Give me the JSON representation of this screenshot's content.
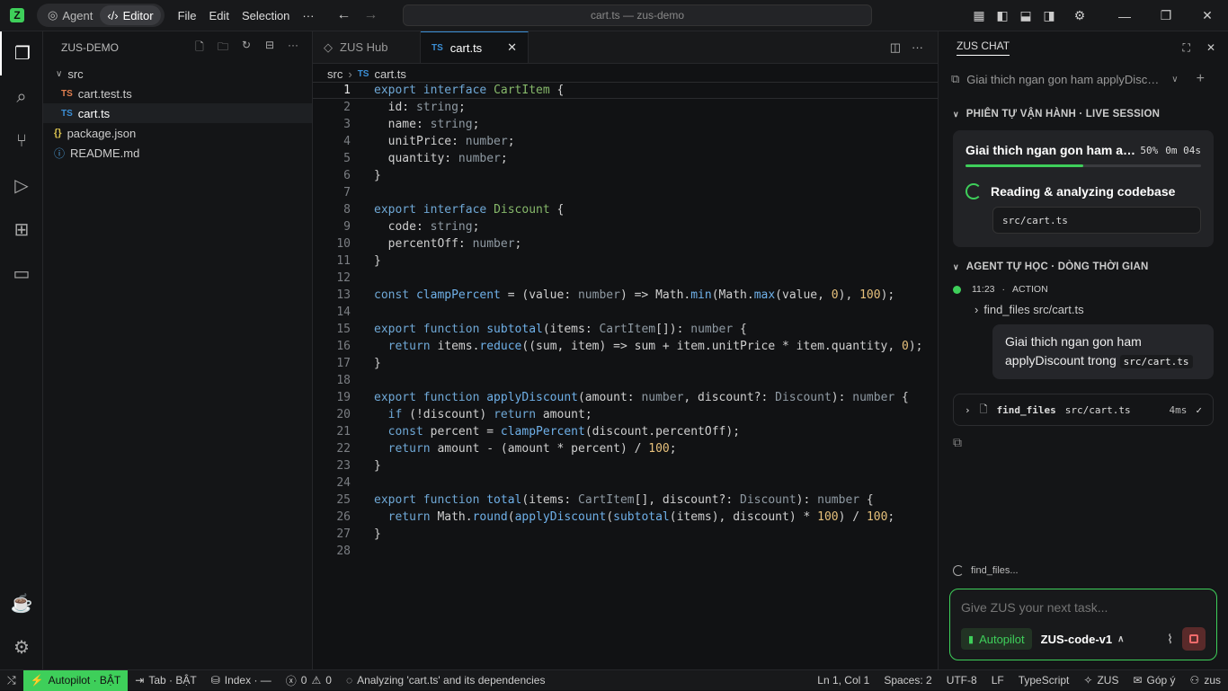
{
  "titlebar": {
    "logo": "Z",
    "modes": [
      "Agent",
      "Editor"
    ],
    "menu": [
      "File",
      "Edit",
      "Selection",
      "···"
    ],
    "command_center": "cart.ts — zus-demo"
  },
  "sidebar": {
    "title": "ZUS-DEMO",
    "folder": "src",
    "files": [
      {
        "badge": "TS",
        "name": "cart.test.ts"
      },
      {
        "badge": "TS",
        "name": "cart.ts"
      }
    ],
    "root_files": [
      {
        "badge": "{}",
        "name": "package.json"
      },
      {
        "badge": "ⓘ",
        "name": "README.md"
      }
    ]
  },
  "editor": {
    "tabs": [
      {
        "label": "ZUS Hub"
      },
      {
        "badge": "TS",
        "label": "cart.ts"
      }
    ],
    "breadcrumb": [
      "src",
      "cart.ts"
    ],
    "breadcrumb_badge": "TS"
  },
  "chat": {
    "title": "ZUS CHAT",
    "history_title": "Giai thich ngan gon ham applyDiscou...",
    "session_section": "PHIÊN TỰ VẬN HÀNH · LIVE SESSION",
    "session": {
      "title": "Giai thich ngan gon ham ap...",
      "percent": "50%",
      "progress": 0.5,
      "elapsed": "0m 04s",
      "status": "Reading & analyzing codebase",
      "file": "src/cart.ts"
    },
    "timeline_section": "AGENT TỰ HỌC · DÒNG THỜI GIAN",
    "timeline": {
      "time": "11:23",
      "kind": "ACTION",
      "action": "find_files src/cart.ts"
    },
    "bubble_text": "Giai thich ngan gon ham applyDiscount trong",
    "bubble_code": "src/cart.ts",
    "tool": {
      "name": "find_files",
      "arg": "src/cart.ts",
      "ms": "4ms"
    },
    "thinking": "find_files...",
    "composer": {
      "placeholder": "Give ZUS your next task...",
      "autopilot": "Autopilot",
      "model": "ZUS-code-v1"
    }
  },
  "statusbar": {
    "autopilot": "Autopilot · BẬT",
    "tab": "Tab · BẬT",
    "index": "Index · —",
    "errors": "0",
    "warnings": "0",
    "analyzing": "Analyzing 'cart.ts' and its dependencies",
    "position": "Ln 1, Col 1",
    "spaces": "Spaces: 2",
    "encoding": "UTF-8",
    "eol": "LF",
    "language": "TypeScript",
    "zus": "ZUS",
    "feedback": "Góp ý",
    "account": "zus"
  },
  "colors": {
    "accent": "#3ecf5a",
    "ts_blue": "#3b8fd6",
    "keyword": "#6fa8d6",
    "number": "#e6c07b"
  },
  "code_lines": [
    [
      [
        "kw",
        "export interface "
      ],
      [
        "ty",
        "CartItem"
      ],
      [
        "op",
        " {"
      ]
    ],
    [
      [
        "op",
        "  id: "
      ],
      [
        "tt",
        "string"
      ],
      [
        "op",
        ";"
      ]
    ],
    [
      [
        "op",
        "  name: "
      ],
      [
        "tt",
        "string"
      ],
      [
        "op",
        ";"
      ]
    ],
    [
      [
        "op",
        "  unitPrice: "
      ],
      [
        "tt",
        "number"
      ],
      [
        "op",
        ";"
      ]
    ],
    [
      [
        "op",
        "  quantity: "
      ],
      [
        "tt",
        "number"
      ],
      [
        "op",
        ";"
      ]
    ],
    [
      [
        "op",
        "}"
      ]
    ],
    [],
    [
      [
        "kw",
        "export interface "
      ],
      [
        "ty",
        "Discount"
      ],
      [
        "op",
        " {"
      ]
    ],
    [
      [
        "op",
        "  code: "
      ],
      [
        "tt",
        "string"
      ],
      [
        "op",
        ";"
      ]
    ],
    [
      [
        "op",
        "  percentOff: "
      ],
      [
        "tt",
        "number"
      ],
      [
        "op",
        ";"
      ]
    ],
    [
      [
        "op",
        "}"
      ]
    ],
    [],
    [
      [
        "kw",
        "const "
      ],
      [
        "fn",
        "clampPercent"
      ],
      [
        "op",
        " = (value: "
      ],
      [
        "tt",
        "number"
      ],
      [
        "op",
        ") => Math."
      ],
      [
        "fn",
        "min"
      ],
      [
        "op",
        "(Math."
      ],
      [
        "fn",
        "max"
      ],
      [
        "op",
        "(value, "
      ],
      [
        "num",
        "0"
      ],
      [
        "op",
        "), "
      ],
      [
        "num",
        "100"
      ],
      [
        "op",
        ");"
      ]
    ],
    [],
    [
      [
        "kw",
        "export function "
      ],
      [
        "fn",
        "subtotal"
      ],
      [
        "op",
        "(items: "
      ],
      [
        "tt",
        "CartItem"
      ],
      [
        "op",
        "[]): "
      ],
      [
        "tt",
        "number"
      ],
      [
        "op",
        " {"
      ]
    ],
    [
      [
        "kw",
        "  return "
      ],
      [
        "op",
        "items."
      ],
      [
        "fn",
        "reduce"
      ],
      [
        "op",
        "((sum, item) => sum + item.unitPrice * item.quantity, "
      ],
      [
        "num",
        "0"
      ],
      [
        "op",
        ");"
      ]
    ],
    [
      [
        "op",
        "}"
      ]
    ],
    [],
    [
      [
        "kw",
        "export function "
      ],
      [
        "fn",
        "applyDiscount"
      ],
      [
        "op",
        "(amount: "
      ],
      [
        "tt",
        "number"
      ],
      [
        "op",
        ", discount?: "
      ],
      [
        "tt",
        "Discount"
      ],
      [
        "op",
        "): "
      ],
      [
        "tt",
        "number"
      ],
      [
        "op",
        " {"
      ]
    ],
    [
      [
        "kw",
        "  if "
      ],
      [
        "op",
        "(!discount) "
      ],
      [
        "kw",
        "return "
      ],
      [
        "op",
        "amount;"
      ]
    ],
    [
      [
        "kw",
        "  const "
      ],
      [
        "op",
        "percent = "
      ],
      [
        "fn",
        "clampPercent"
      ],
      [
        "op",
        "(discount.percentOff);"
      ]
    ],
    [
      [
        "kw",
        "  return "
      ],
      [
        "op",
        "amount - (amount * percent) / "
      ],
      [
        "num",
        "100"
      ],
      [
        "op",
        ";"
      ]
    ],
    [
      [
        "op",
        "}"
      ]
    ],
    [],
    [
      [
        "kw",
        "export function "
      ],
      [
        "fn",
        "total"
      ],
      [
        "op",
        "(items: "
      ],
      [
        "tt",
        "CartItem"
      ],
      [
        "op",
        "[], discount?: "
      ],
      [
        "tt",
        "Discount"
      ],
      [
        "op",
        "): "
      ],
      [
        "tt",
        "number"
      ],
      [
        "op",
        " {"
      ]
    ],
    [
      [
        "kw",
        "  return "
      ],
      [
        "op",
        "Math."
      ],
      [
        "fn",
        "round"
      ],
      [
        "op",
        "("
      ],
      [
        "fn",
        "applyDiscount"
      ],
      [
        "op",
        "("
      ],
      [
        "fn",
        "subtotal"
      ],
      [
        "op",
        "(items), discount) * "
      ],
      [
        "num",
        "100"
      ],
      [
        "op",
        ") / "
      ],
      [
        "num",
        "100"
      ],
      [
        "op",
        ";"
      ]
    ],
    [
      [
        "op",
        "}"
      ]
    ],
    []
  ]
}
